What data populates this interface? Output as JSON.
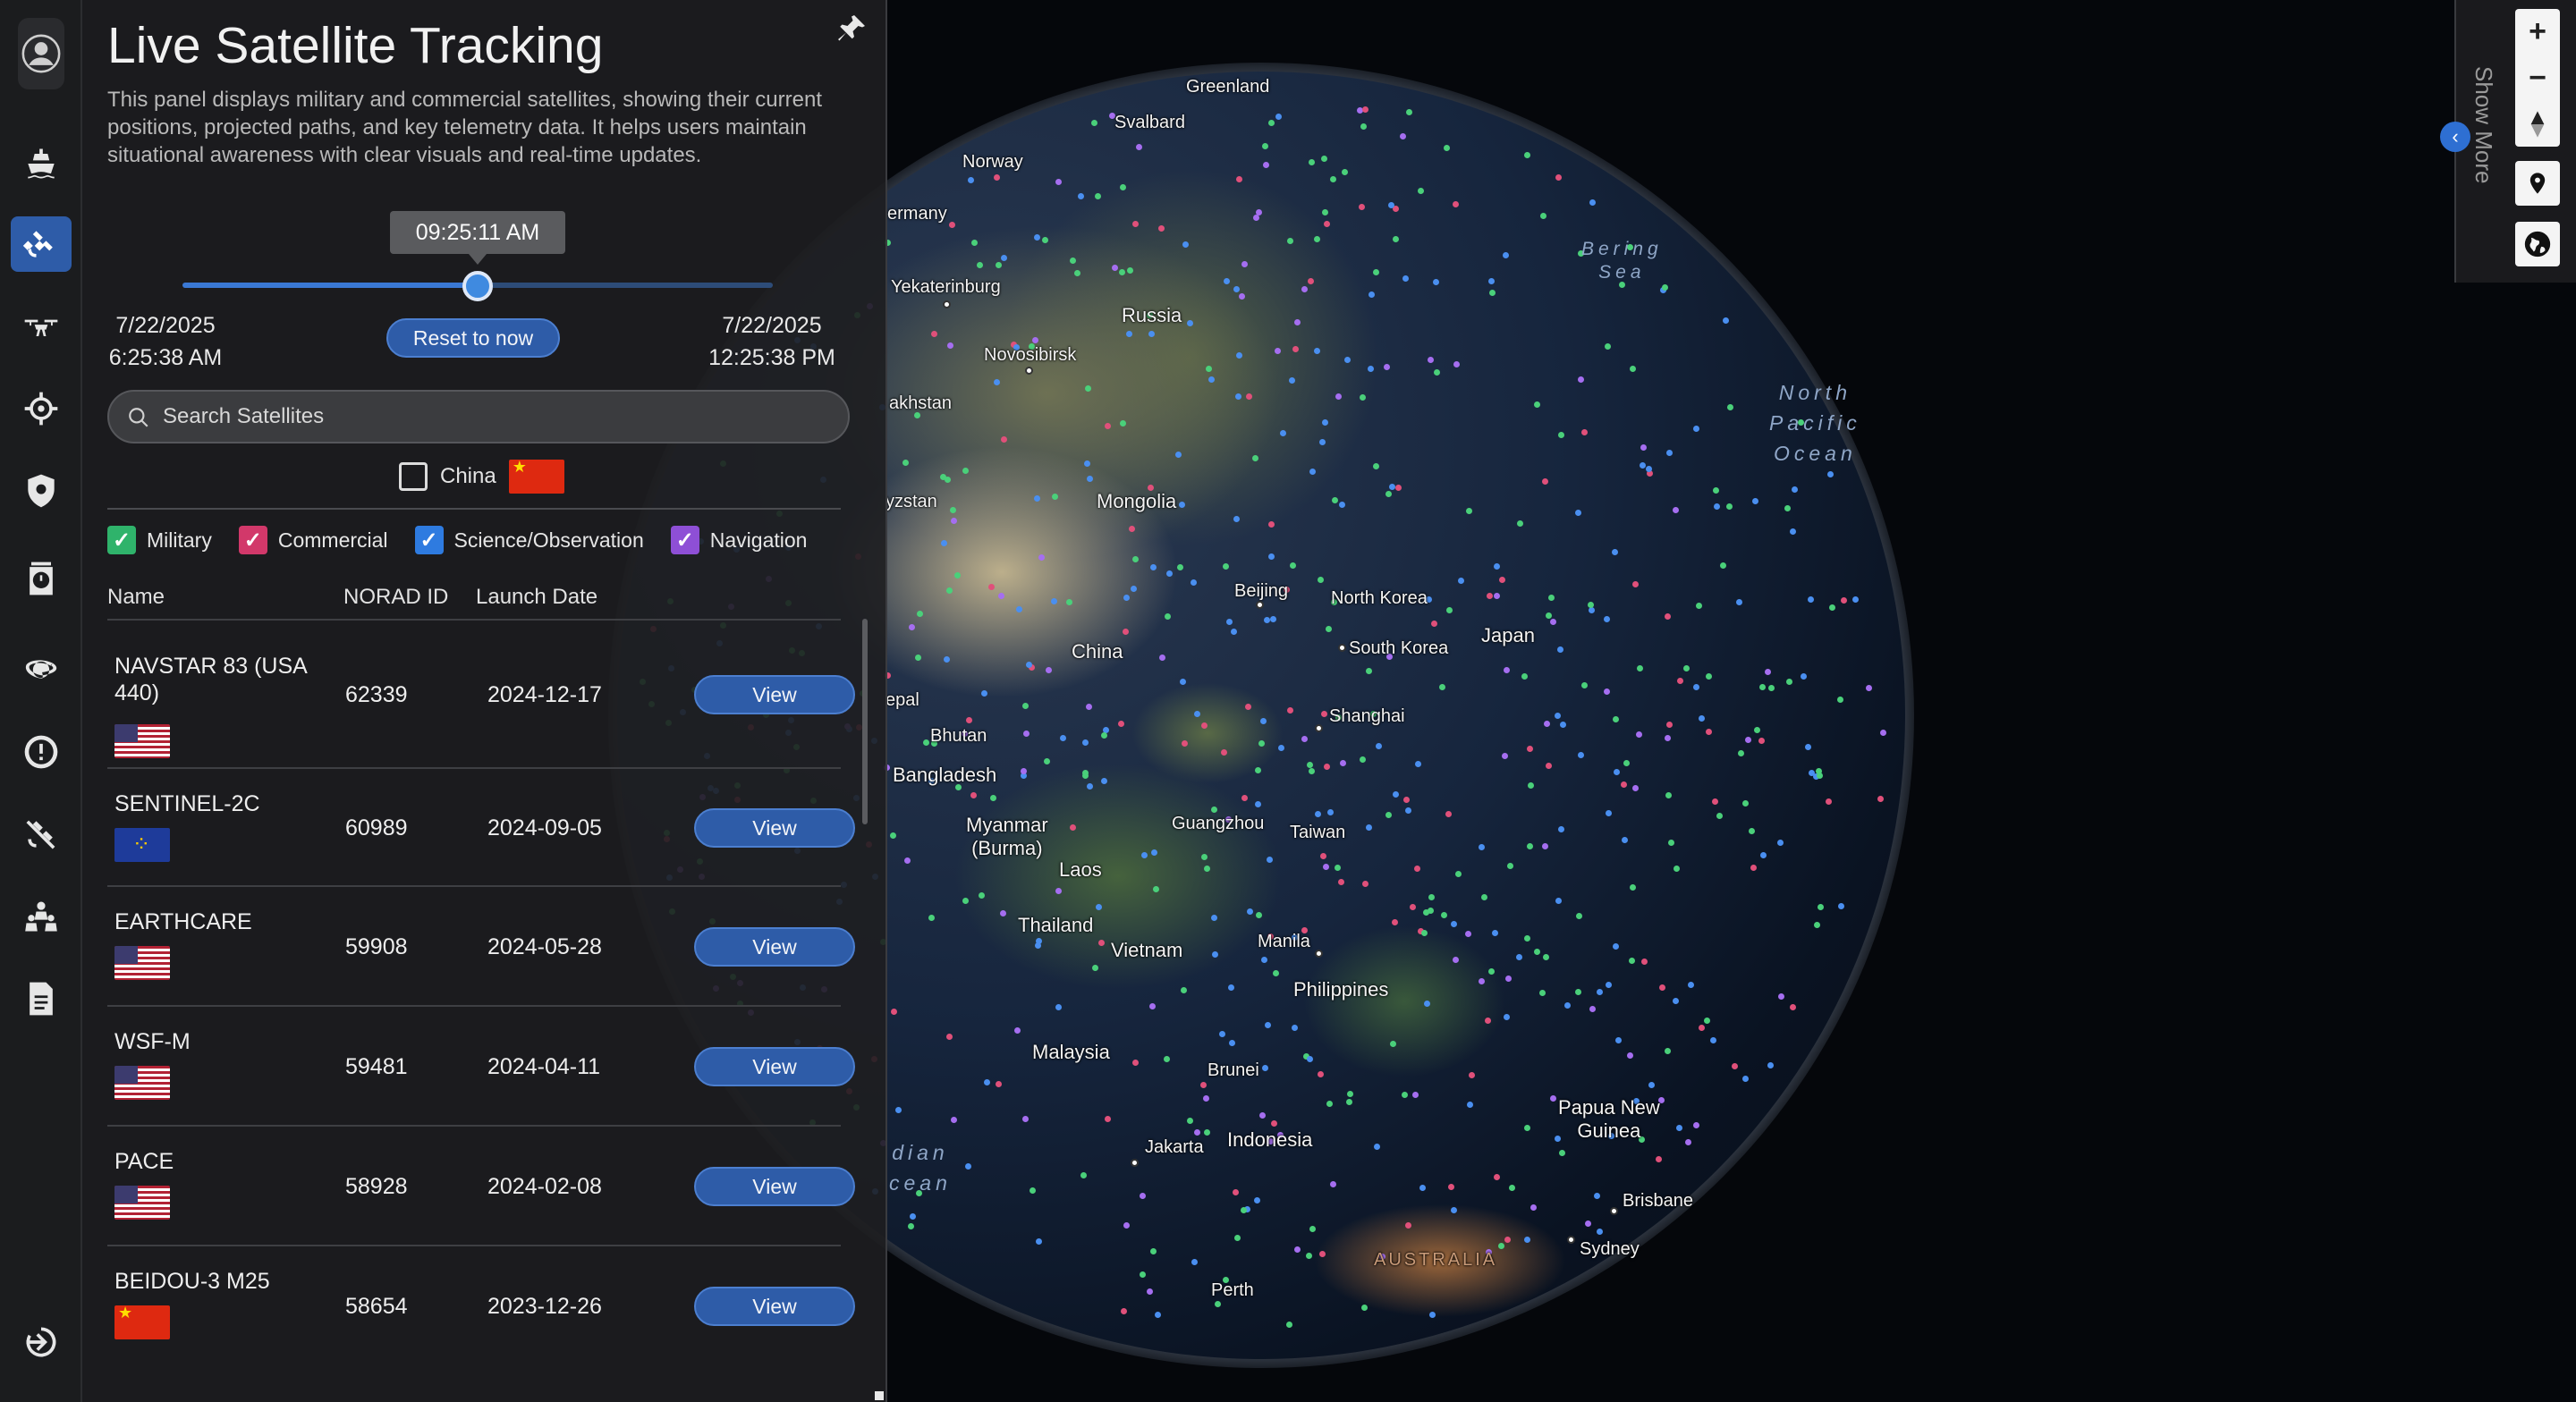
{
  "panel": {
    "title": "Live Satellite Tracking",
    "description": "This panel displays military and commercial satellites, showing their current positions, projected paths, and key telemetry data. It helps users maintain situational awareness with clear visuals and real-time updates."
  },
  "timeline": {
    "current_time": "09:25:11 AM",
    "progress": 0.5,
    "start_date": "7/22/2025",
    "start_time": "6:25:38 AM",
    "end_date": "7/22/2025",
    "end_time": "12:25:38 PM",
    "reset_label": "Reset to now"
  },
  "search": {
    "placeholder": "Search Satellites"
  },
  "country_filter": {
    "label": "China",
    "checked": false
  },
  "categories": [
    {
      "label": "Military",
      "color": "#2fb36b",
      "checked": true
    },
    {
      "label": "Commercial",
      "color": "#d2386a",
      "checked": true
    },
    {
      "label": "Science/Observation",
      "color": "#2e7be0",
      "checked": true
    },
    {
      "label": "Navigation",
      "color": "#8e4fd6",
      "checked": true
    }
  ],
  "table": {
    "columns": [
      "Name",
      "NORAD ID",
      "Launch Date"
    ],
    "view_label": "View",
    "rows": [
      {
        "name": "NAVSTAR 83 (USA 440)",
        "norad": "62339",
        "launch": "2024-12-17",
        "flag": "us"
      },
      {
        "name": "SENTINEL-2C",
        "norad": "60989",
        "launch": "2024-09-05",
        "flag": "eu"
      },
      {
        "name": "EARTHCARE",
        "norad": "59908",
        "launch": "2024-05-28",
        "flag": "us"
      },
      {
        "name": "WSF-M",
        "norad": "59481",
        "launch": "2024-04-11",
        "flag": "us"
      },
      {
        "name": "PACE",
        "norad": "58928",
        "launch": "2024-02-08",
        "flag": "us"
      },
      {
        "name": "BEIDOU-3 M25",
        "norad": "58654",
        "launch": "2023-12-26",
        "flag": "cn"
      }
    ]
  },
  "map": {
    "labels": {
      "greenland": "Greenland",
      "svalbard": "Svalbard",
      "norway": "Norway",
      "germany": "ermany",
      "yekaterinburg": "Yekaterinburg",
      "russia": "Russia",
      "novosibirsk": "Novosibirsk",
      "kazakhstan": "akhstan",
      "kyrgyzstan": "yzstan",
      "mongolia": "Mongolia",
      "china": "China",
      "beijing": "Beijing",
      "north_korea": "North Korea",
      "south_korea": "South Korea",
      "japan": "Japan",
      "shanghai": "Shanghai",
      "nepal": "epal",
      "bhutan": "Bhutan",
      "bangladesh": "Bangladesh",
      "myanmar": "Myanmar\n(Burma)",
      "guangzhou": "Guangzhou",
      "taiwan": "Taiwan",
      "laos": "Laos",
      "thailand": "Thailand",
      "vietnam": "Vietnam",
      "manila": "Manila",
      "philippines": "Philippines",
      "malaysia": "Malaysia",
      "brunei": "Brunei",
      "indonesia": "Indonesia",
      "jakarta": "Jakarta",
      "papua": "Papua New\nGuinea",
      "brisbane": "Brisbane",
      "sydney": "Sydney",
      "perth": "Perth",
      "australia": "AUSTRALIA",
      "bering": "Bering\nSea",
      "north_pacific": "North\nPacific\nOcean",
      "indian_ocean": "dian\ncean"
    },
    "show_more_label": "Show More"
  },
  "colors": {
    "accent": "#2e5ca8",
    "military": "#4ad07a",
    "commercial": "#e0507a",
    "science": "#4a8ff0",
    "navigation": "#a56ef0"
  }
}
